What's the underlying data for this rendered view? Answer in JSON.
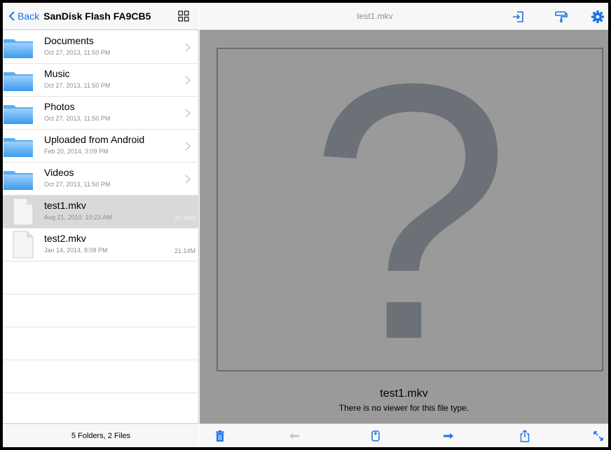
{
  "left_nav": {
    "back_label": "Back",
    "title": "SanDisk Flash FA9CB5"
  },
  "items": [
    {
      "name": "Documents",
      "date": "Oct 27, 2013, 11:50 PM",
      "kind": "folder",
      "size": ""
    },
    {
      "name": "Music",
      "date": "Oct 27, 2013, 11:50 PM",
      "kind": "folder",
      "size": ""
    },
    {
      "name": "Photos",
      "date": "Oct 27, 2013, 11:50 PM",
      "kind": "folder",
      "size": ""
    },
    {
      "name": "Uploaded from Android",
      "date": "Feb 20, 2014, 3:09 PM",
      "kind": "folder",
      "size": ""
    },
    {
      "name": "Videos",
      "date": "Oct 27, 2013, 11:50 PM",
      "kind": "folder",
      "size": ""
    },
    {
      "name": "test1.mkv",
      "date": "Aug 21, 2010, 10:23 AM",
      "kind": "file",
      "size": "23.34M",
      "selected": true
    },
    {
      "name": "test2.mkv",
      "date": "Jan 14, 2014, 8:08 PM",
      "kind": "file",
      "size": "21.14M"
    }
  ],
  "left_footer": "5 Folders, 2 Files",
  "right_nav": {
    "title": "test1.mkv",
    "icons": [
      "import-icon",
      "paint-roller-icon",
      "gear-icon"
    ]
  },
  "viewer": {
    "placeholder_glyph": "?",
    "file_name": "test1.mkv",
    "message": "There is no viewer for this file type."
  },
  "toolbar": {
    "icons": [
      "trash-icon",
      "previous-arrow-icon",
      "mouse-icon",
      "next-arrow-icon",
      "share-icon",
      "fullscreen-icon"
    ]
  },
  "colors": {
    "accent": "#1a73e8",
    "viewer_bg": "#9a9a9a",
    "question_mark": "#6c7178",
    "selected_row": "#d9d9d9"
  }
}
